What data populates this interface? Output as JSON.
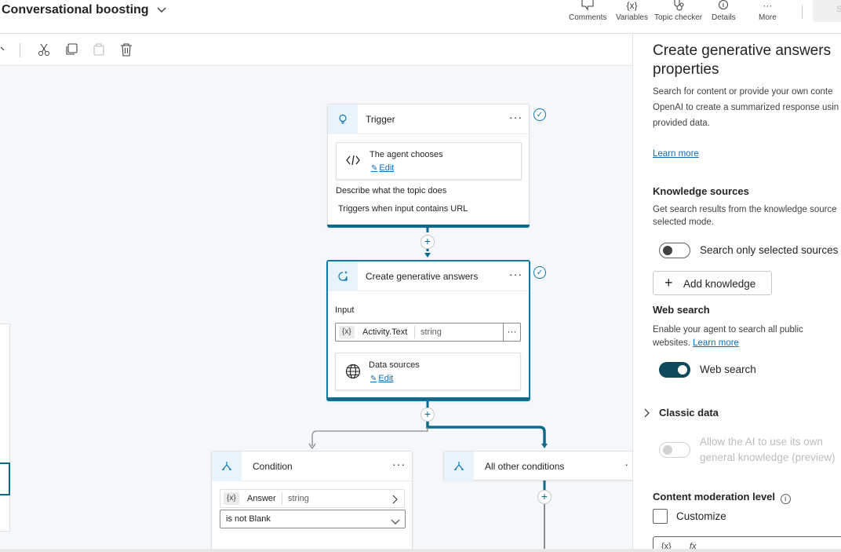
{
  "header": {
    "topic_title": "Conversational boosting",
    "actions": [
      {
        "label": "Comments",
        "icon": "comment-icon"
      },
      {
        "label": "Variables",
        "icon": "variables-icon"
      },
      {
        "label": "Topic checker",
        "icon": "stethoscope-icon"
      },
      {
        "label": "Details",
        "icon": "info-icon"
      },
      {
        "label": "More",
        "icon": "more-icon"
      }
    ],
    "save_label": "S"
  },
  "nodes": {
    "trigger": {
      "title": "Trigger",
      "more": "···",
      "card_title": "The agent chooses",
      "edit": "Edit",
      "describe_label": "Describe what the topic does",
      "description": "Triggers when input contains URL"
    },
    "generative": {
      "title": "Create generative answers",
      "more": "···",
      "input_label": "Input",
      "var_pill": "{x}",
      "var_name": "Activity.Text",
      "var_type": "string",
      "var_more": "···",
      "sources_title": "Data sources",
      "edit": "Edit"
    },
    "condition": {
      "title": "Condition",
      "more": "···",
      "var_pill": "{x}",
      "var_name": "Answer",
      "var_type": "string",
      "operator": "is not Blank"
    },
    "other": {
      "title": "All other conditions",
      "more": "·"
    }
  },
  "panel": {
    "title": "Create generative answers properties",
    "desc_lines": [
      "Search for content or provide your own conte",
      "OpenAI to create a summarized response usin",
      "provided data."
    ],
    "learn_more": "Learn more",
    "knowledge": {
      "heading": "Knowledge sources",
      "desc_lines": [
        "Get search results from the knowledge source",
        "selected mode."
      ],
      "toggle_label": "Search only selected sources",
      "toggle_on": false,
      "add_label": "Add knowledge"
    },
    "web": {
      "heading": "Web search",
      "desc_line1": "Enable your agent to search all public",
      "desc_line2": "websites.",
      "learn_more": "Learn more",
      "toggle_label": "Web search",
      "toggle_on": true
    },
    "classic": {
      "heading": "Classic data",
      "toggle_label_line1": "Allow the AI to use its own",
      "toggle_label_line2": "general knowledge (preview)"
    },
    "moderation": {
      "heading": "Content moderation level",
      "customize_label": "Customize",
      "box_pill": "{x}",
      "box_fx": "fx"
    }
  },
  "colors": {
    "accent": "#0f6a8a",
    "link": "#0f6cbd",
    "toggle_on": "#0f4a5c"
  }
}
